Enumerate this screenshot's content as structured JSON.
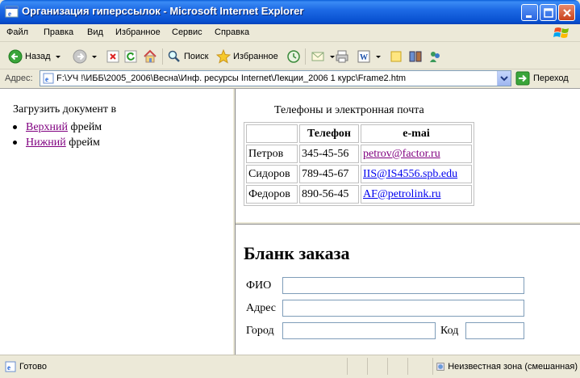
{
  "window": {
    "title": "Организация гиперссылок - Microsoft Internet Explorer"
  },
  "menu": [
    "Файл",
    "Правка",
    "Вид",
    "Избранное",
    "Сервис",
    "Справка"
  ],
  "toolbar": {
    "back": "Назад",
    "search": "Поиск",
    "favorites": "Избранное"
  },
  "address": {
    "label": "Адрес:",
    "url": "F:\\УЧ !\\ИББ\\2005_2006\\Весна\\Инф. ресурсы Internet\\Лекции_2006 1 курс\\Frame2.htm",
    "go": "Переход"
  },
  "left_frame": {
    "intro": "Загрузить документ в",
    "items": [
      {
        "link": "Верхний",
        "suffix": " фрейм"
      },
      {
        "link": "Нижний",
        "suffix": " фрейм"
      }
    ]
  },
  "contacts": {
    "caption": "Телефоны и электронная почта",
    "headers": [
      "",
      "Телефон",
      "e-mai"
    ],
    "rows": [
      {
        "name": "Петров",
        "phone": "345-45-56",
        "email": "petrov@factor.ru"
      },
      {
        "name": "Сидоров",
        "phone": "789-45-67",
        "email": "IIS@IS4556.spb.edu"
      },
      {
        "name": "Федоров",
        "phone": "890-56-45",
        "email": "AF@petrolink.ru"
      }
    ]
  },
  "order_form": {
    "title": "Бланк заказа",
    "fio_label": "ФИО",
    "address_label": "Адрес",
    "city_label": "Город",
    "code_label": "Код",
    "fio_value": "",
    "address_value": "",
    "city_value": "",
    "code_value": ""
  },
  "status": {
    "ready": "Готово",
    "zone": "Неизвестная зона (смешанная)"
  }
}
